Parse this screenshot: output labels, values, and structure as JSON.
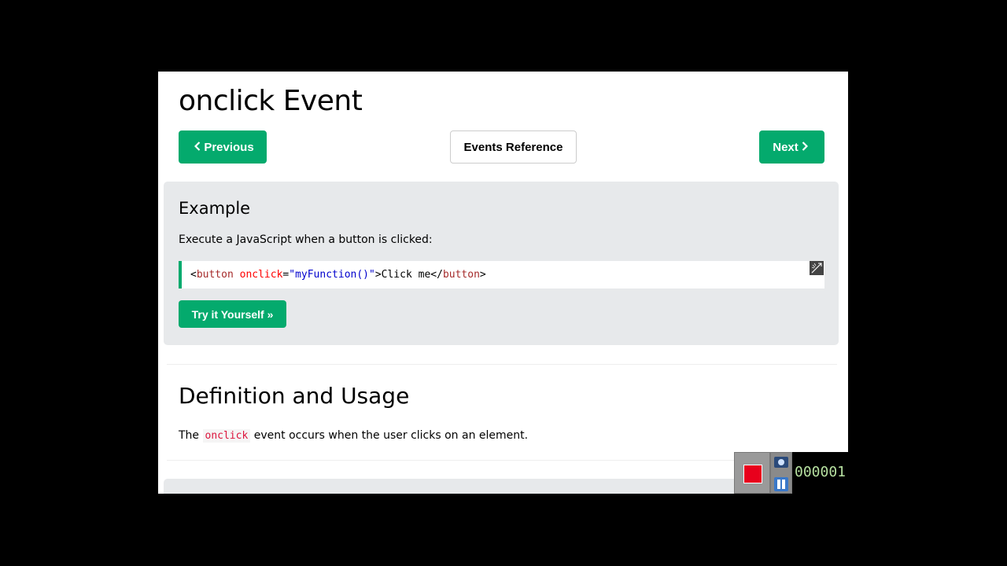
{
  "page": {
    "title": "onclick Event"
  },
  "nav": {
    "previous_label": "Previous",
    "reference_label": "Events Reference",
    "next_label": "Next",
    "previous_icon": "chevron-left-icon",
    "next_icon": "chevron-right-icon"
  },
  "example": {
    "heading": "Example",
    "description": "Execute a JavaScript when a button is clicked:",
    "code": {
      "open_bracket": "<",
      "tag": "button",
      "attr": " onclick",
      "equals": "=",
      "value": "\"myFunction()\"",
      "close_bracket": ">",
      "text": "Click me",
      "end_open": "</",
      "end_tag": "button",
      "end_close": ">"
    },
    "try_label": "Try it Yourself »"
  },
  "definition": {
    "heading": "Definition and Usage",
    "text_before": "The ",
    "code_term": "onclick",
    "text_after": " event occurs when the user clicks on an element."
  },
  "recorder": {
    "timer": "000001"
  },
  "colors": {
    "accent": "#04aa6d",
    "example_bg": "#e7e9eb",
    "record_red": "#e8001c"
  }
}
